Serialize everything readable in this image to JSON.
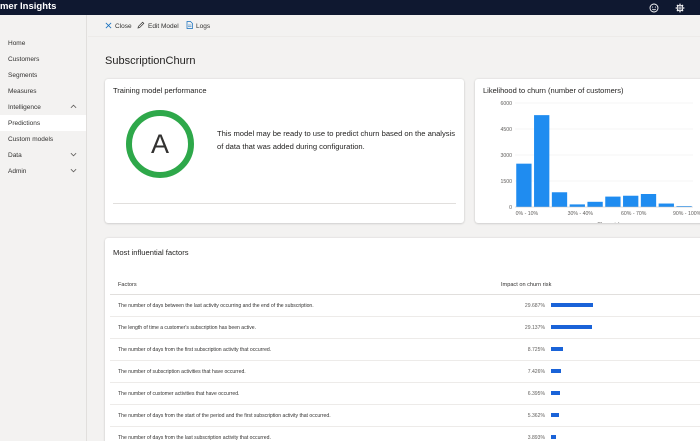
{
  "app": {
    "title": "tomer Insights"
  },
  "topbar_icons": [
    "smiley-icon",
    "gear-icon"
  ],
  "sidebar": {
    "items": [
      {
        "label": "Home",
        "expandable": false,
        "active": false
      },
      {
        "label": "Customers",
        "expandable": false,
        "active": false
      },
      {
        "label": "Segments",
        "expandable": false,
        "active": false
      },
      {
        "label": "Measures",
        "expandable": false,
        "active": false
      },
      {
        "label": "Intelligence",
        "expandable": true,
        "expanded": true,
        "active": false
      },
      {
        "label": "Predictions",
        "expandable": false,
        "active": true
      },
      {
        "label": "Custom models",
        "expandable": false,
        "active": false
      },
      {
        "label": "Data",
        "expandable": true,
        "expanded": false,
        "active": false
      },
      {
        "label": "Admin",
        "expandable": true,
        "expanded": false,
        "active": false
      }
    ]
  },
  "commands": {
    "close": "Close",
    "edit": "Edit Model",
    "logs": "Logs"
  },
  "page": {
    "title": "SubscriptionChurn"
  },
  "performance": {
    "title": "Training model performance",
    "grade": "A",
    "grade_color": "#2ea84a",
    "message": "This model may be ready to use to predict churn based on the analysis of data that was added during configuration."
  },
  "likelihood": {
    "title": "Likelihood to churn (number of customers)",
    "chart_data": {
      "type": "bar",
      "title": "Likelihood to churn (number of customers)",
      "xlabel": "Churn risk",
      "ylabel": "",
      "ylim": [
        0,
        6000
      ],
      "yticks": [
        "6000",
        "4500",
        "3000",
        "1500",
        "0"
      ],
      "xticks": [
        "0% - 10%",
        "30% - 40%",
        "60% - 70%",
        "90% - 100%"
      ],
      "bar_color": "#1f8cf0",
      "values": [
        2500,
        5300,
        850,
        150,
        300,
        600,
        650,
        750,
        200,
        50
      ]
    }
  },
  "factors": {
    "title": "Most influential factors",
    "col_factors": "Factors",
    "col_impact": "Impact on churn risk",
    "bar_color": "#1a63d8",
    "rows": [
      {
        "factor": "The number of days between the last activity occurring and the end of the subscription.",
        "impact": "29.687%",
        "share": 0.29687
      },
      {
        "factor": "The length of time a customer's subscription has been active.",
        "impact": "29.137%",
        "share": 0.29137
      },
      {
        "factor": "The number of days from the first subscription activity that occurred.",
        "impact": "8.725%",
        "share": 0.08725
      },
      {
        "factor": "The number of subscription activities that have occurred.",
        "impact": "7.426%",
        "share": 0.07426
      },
      {
        "factor": "The number of customer activities that have occurred.",
        "impact": "6.395%",
        "share": 0.06395
      },
      {
        "factor": "The number of days from the start of the period and the first subscription activity that occurred.",
        "impact": "5.362%",
        "share": 0.05362
      },
      {
        "factor": "The number of days from the last subscription activity that occurred.",
        "impact": "3.893%",
        "share": 0.03893
      }
    ]
  }
}
